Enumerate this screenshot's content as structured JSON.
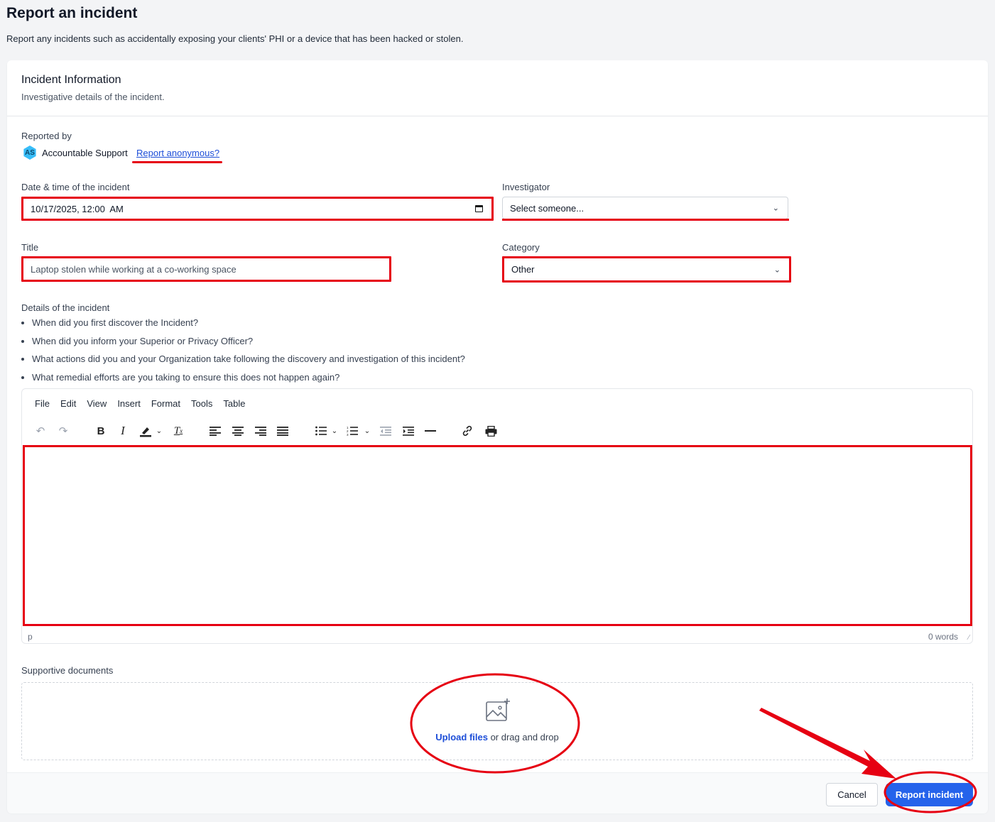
{
  "page": {
    "title": "Report an incident",
    "subtitle": "Report any incidents such as accidentally exposing your clients' PHI or a device that has been hacked or stolen."
  },
  "card": {
    "title": "Incident Information",
    "subtitle": "Investigative details of the incident."
  },
  "reported_by": {
    "label": "Reported by",
    "avatar_initials": "AS",
    "name": "Accountable Support",
    "anonymous_link": "Report anonymous?"
  },
  "fields": {
    "datetime_label": "Date & time of the incident",
    "datetime_value": "10/17/2025, 12:00  AM",
    "investigator_label": "Investigator",
    "investigator_value": "Select someone...",
    "title_label": "Title",
    "title_value": "Laptop stolen while working at a co-working space",
    "category_label": "Category",
    "category_value": "Other"
  },
  "details": {
    "label": "Details of the incident",
    "questions": [
      "When did you first discover the Incident?",
      "When did you inform your Superior or Privacy Officer?",
      "What actions did you and your Organization take following the discovery and investigation of this incident?",
      "What remedial efforts are you taking to ensure this does not happen again?"
    ]
  },
  "editor": {
    "menu": [
      "File",
      "Edit",
      "View",
      "Insert",
      "Format",
      "Tools",
      "Table"
    ],
    "status_path": "p",
    "word_count": "0 words"
  },
  "documents": {
    "label": "Supportive documents",
    "upload_link": "Upload files",
    "upload_rest": " or drag and drop"
  },
  "footer": {
    "cancel": "Cancel",
    "submit": "Report incident"
  },
  "colors": {
    "accent": "#2563eb",
    "annotation_red": "#e60012"
  }
}
